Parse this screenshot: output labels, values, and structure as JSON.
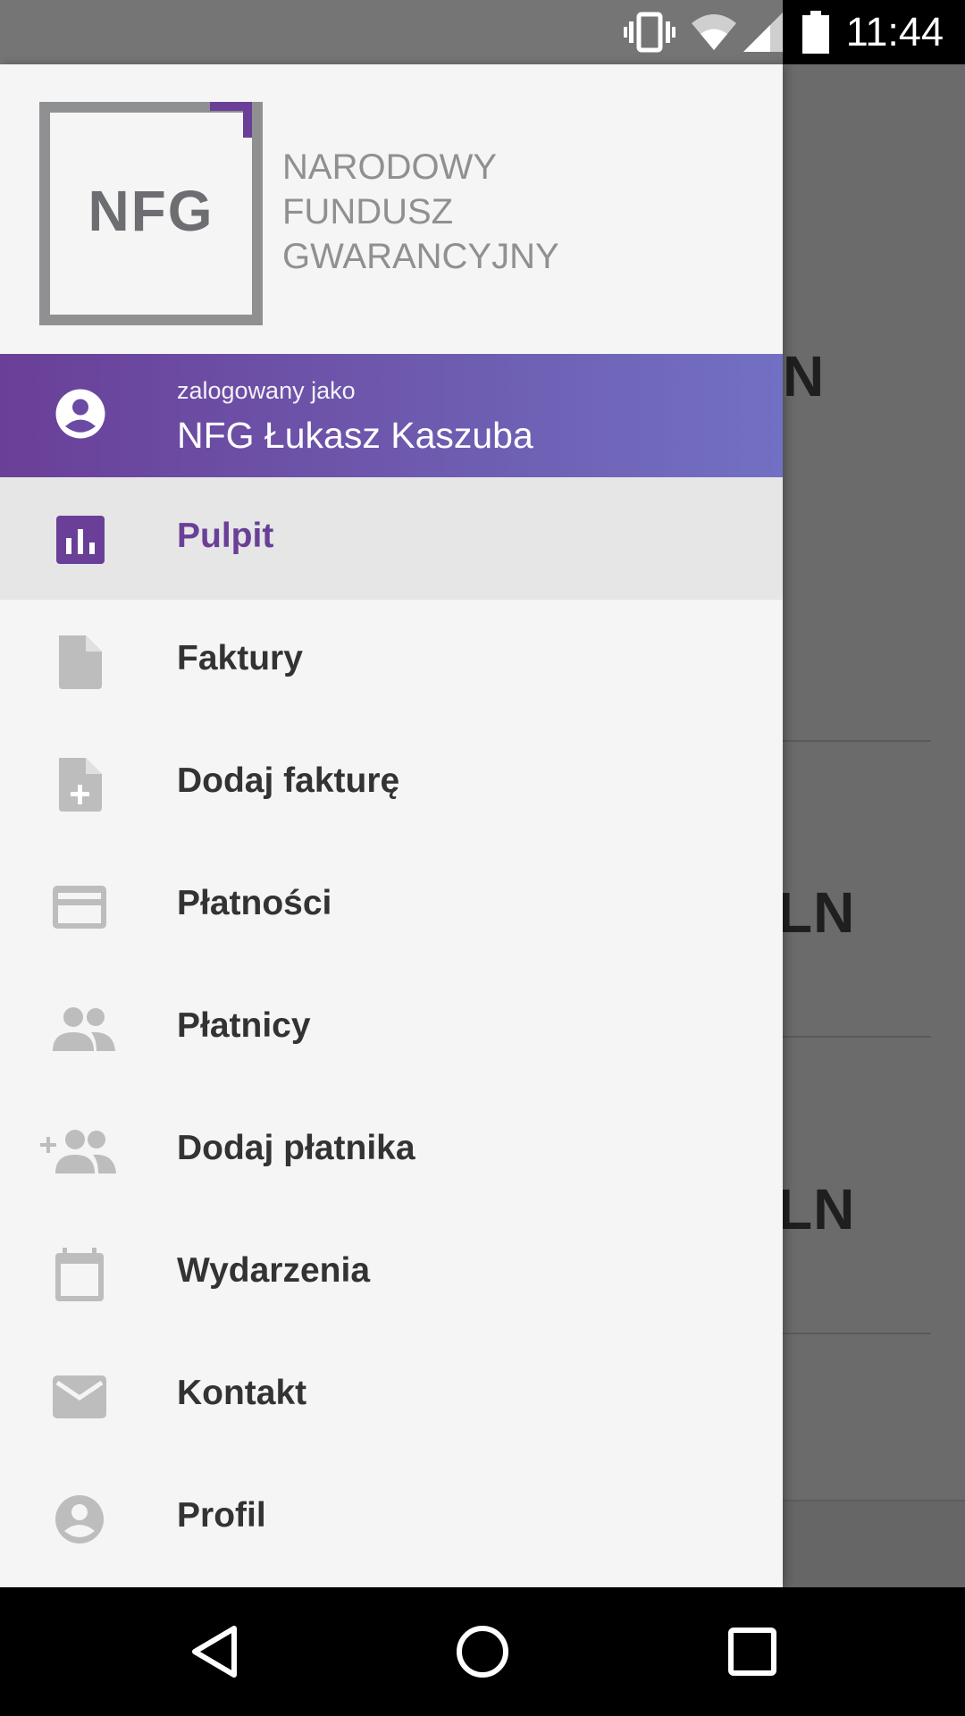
{
  "status_bar": {
    "time": "11:44",
    "icons": [
      "vibrate-icon",
      "wifi-icon",
      "cell-signal-icon",
      "battery-icon"
    ]
  },
  "background_content": {
    "fragments": [
      "N",
      "LN",
      "LN"
    ]
  },
  "drawer": {
    "logo": {
      "abbreviation": "NFG",
      "name_lines": [
        "NARODOWY",
        "FUNDUSZ",
        "GWARANCYJNY"
      ]
    },
    "user": {
      "label": "zalogowany jako",
      "name": "NFG Łukasz Kaszuba"
    },
    "menu": [
      {
        "label": "Pulpit",
        "icon": "chart-icon",
        "active": true
      },
      {
        "label": "Faktury",
        "icon": "document-icon",
        "active": false
      },
      {
        "label": "Dodaj fakturę",
        "icon": "add-document-icon",
        "active": false
      },
      {
        "label": "Płatności",
        "icon": "credit-card-icon",
        "active": false
      },
      {
        "label": "Płatnicy",
        "icon": "people-icon",
        "active": false
      },
      {
        "label": "Dodaj płatnika",
        "icon": "add-people-icon",
        "active": false
      },
      {
        "label": "Wydarzenia",
        "icon": "calendar-icon",
        "active": false
      },
      {
        "label": "Kontakt",
        "icon": "mail-icon",
        "active": false
      },
      {
        "label": "Profil",
        "icon": "account-icon",
        "active": false
      }
    ]
  },
  "colors": {
    "accent": "#6a3f98",
    "banner_end": "#7270c4",
    "drawer_bg": "#f5f5f5",
    "active_bg": "#e6e6e6",
    "icon_grey": "#bdbdbd"
  },
  "nav_bar": {
    "buttons": [
      "back-icon",
      "home-icon",
      "recents-icon"
    ]
  }
}
